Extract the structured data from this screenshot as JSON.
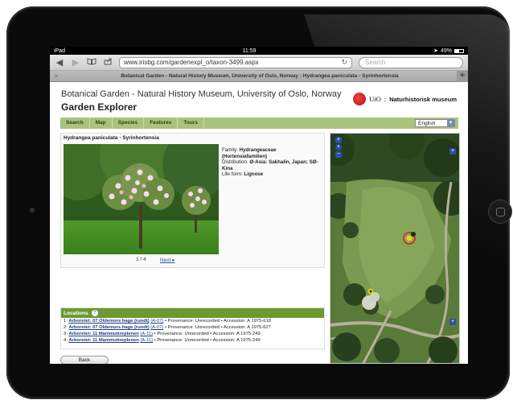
{
  "status": {
    "device": "iPad",
    "time": "11:59",
    "battery": "49%"
  },
  "browser": {
    "url": "www.irisbg.com/gardenexpl_o/taxon-3499.aspx",
    "search_placeholder": "Search",
    "tab_title": "Botanical Garden - Natural History Museum, University of Oslo, Norway : Hydrangea paniculata - Syrinhortensia",
    "tab_close": "×",
    "new_tab": "+"
  },
  "site": {
    "title_line1": "Botanical Garden - Natural History Museum, University of Oslo, Norway",
    "title_line2": "Garden Explorer",
    "logo_text1": "UiO",
    "logo_sep": ":",
    "logo_text2": "Naturhistorisk museum"
  },
  "menu": {
    "items": [
      "Search",
      "Map",
      "Species",
      "Features",
      "Tours"
    ],
    "language": "English"
  },
  "plant": {
    "title": "Hydrangea paniculata - Syrinhortensia",
    "family_label": "Family: ",
    "family": "Hydrangeaceae (Hortensiafamilien)",
    "distribution_label": "Distribution: ",
    "distribution": "Ø-Asia: Sakhalin, Japan; SØ-Kina",
    "lifeform_label": "Life form: ",
    "lifeform": "Lignose",
    "photo_count": "1 / 4",
    "next_label": "Next"
  },
  "locations": {
    "header": "Locations",
    "rows": [
      {
        "num": "1: ",
        "name": "Arboretet: 07 Oldemors hage (rundt)",
        "code": "(A-07)",
        "rest": " • Provenance: Unrecorded • Accession: A 1975-618"
      },
      {
        "num": "2: ",
        "name": "Arboretet: 07 Oldemors hage (rundt)",
        "code": "(A-07)",
        "rest": " • Provenance: Unrecorded • Accession: A 1975-627"
      },
      {
        "num": "3: ",
        "name": "Arboretet: 11 Mammuttreplenen",
        "code": "(A-11)",
        "rest": " • Provenance: Unrecorded • Accession: A 1975-249"
      },
      {
        "num": "4: ",
        "name": "Arboretet: 11 Mammuttreplenen",
        "code": "(A-11)",
        "rest": " • Provenance: Unrecorded • Accession: A 1975-249"
      }
    ]
  },
  "back_label": "Back",
  "icons": {
    "back": "back-arrow-icon",
    "forward": "forward-arrow-icon",
    "bookmarks": "book-icon",
    "share": "share-icon",
    "reload": "reload-icon",
    "help": "help-icon"
  },
  "colors": {
    "menu_green": "#a8c47a",
    "location_green": "#6b9a32",
    "uio_red": "#b01010",
    "link_blue": "#1d3e7e"
  }
}
